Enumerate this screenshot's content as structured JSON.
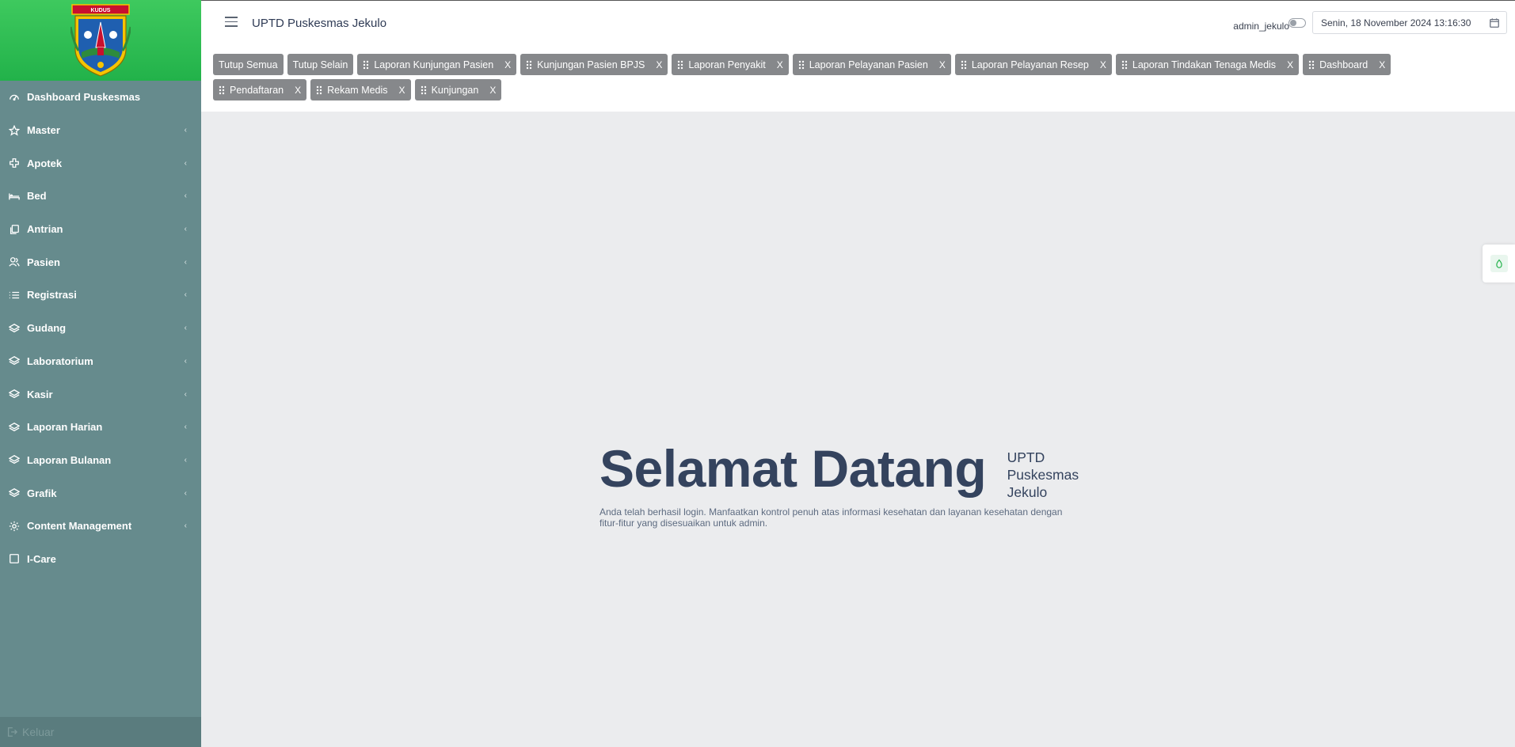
{
  "app": {
    "title": "UPTD Puskesmas Jekulo"
  },
  "header": {
    "user": "admin_jekulo",
    "datetime": "Senin, 18 November 2024 13:16:30"
  },
  "sidebar": {
    "items": [
      {
        "label": "Dashboard Puskesmas",
        "icon": "dashboard-icon",
        "has_submenu": false
      },
      {
        "label": "Master",
        "icon": "star-icon",
        "has_submenu": true
      },
      {
        "label": "Apotek",
        "icon": "plus-cross-icon",
        "has_submenu": true
      },
      {
        "label": "Bed",
        "icon": "bed-icon",
        "has_submenu": true
      },
      {
        "label": "Antrian",
        "icon": "copy-icon",
        "has_submenu": true
      },
      {
        "label": "Pasien",
        "icon": "users-icon",
        "has_submenu": true
      },
      {
        "label": "Registrasi",
        "icon": "list-icon",
        "has_submenu": true
      },
      {
        "label": "Gudang",
        "icon": "layers-icon",
        "has_submenu": true
      },
      {
        "label": "Laboratorium",
        "icon": "layers-icon",
        "has_submenu": true
      },
      {
        "label": "Kasir",
        "icon": "layers-icon",
        "has_submenu": true
      },
      {
        "label": "Laporan Harian",
        "icon": "layers-icon",
        "has_submenu": true
      },
      {
        "label": "Laporan Bulanan",
        "icon": "layers-icon",
        "has_submenu": true
      },
      {
        "label": "Grafik",
        "icon": "layers-icon",
        "has_submenu": true
      },
      {
        "label": "Content Management",
        "icon": "gear-icon",
        "has_submenu": true
      },
      {
        "label": "I-Care",
        "icon": "square-icon",
        "has_submenu": false
      }
    ],
    "chevron": "‹",
    "logout": "Keluar"
  },
  "tabs": {
    "close_all": "Tutup Semua",
    "close_others": "Tutup Selain",
    "close_glyph": "X",
    "row1": [
      "Laporan Kunjungan Pasien",
      "Kunjungan Pasien BPJS",
      "Laporan Penyakit",
      "Laporan Pelayanan Pasien",
      "Laporan Pelayanan Resep",
      "Laporan Tindakan Tenaga Medis",
      "Dashboard"
    ],
    "row2": [
      "Pendaftaran",
      "Rekam Medis",
      "Kunjungan"
    ]
  },
  "welcome": {
    "title": "Selamat Datang",
    "subtitle": "UPTD Puskesmas Jekulo",
    "description": "Anda telah berhasil login. Manfaatkan kontrol penuh atas informasi kesehatan dan layanan kesehatan dengan fitur-fitur yang disesuaikan untuk admin."
  },
  "crest": {
    "banner_text": "KUDUS"
  },
  "colors": {
    "sidebar": "#668b8d",
    "logo_bg": "#22b24a",
    "tab": "#86888b",
    "main_bg": "#ebecee",
    "heading": "#34435e"
  }
}
